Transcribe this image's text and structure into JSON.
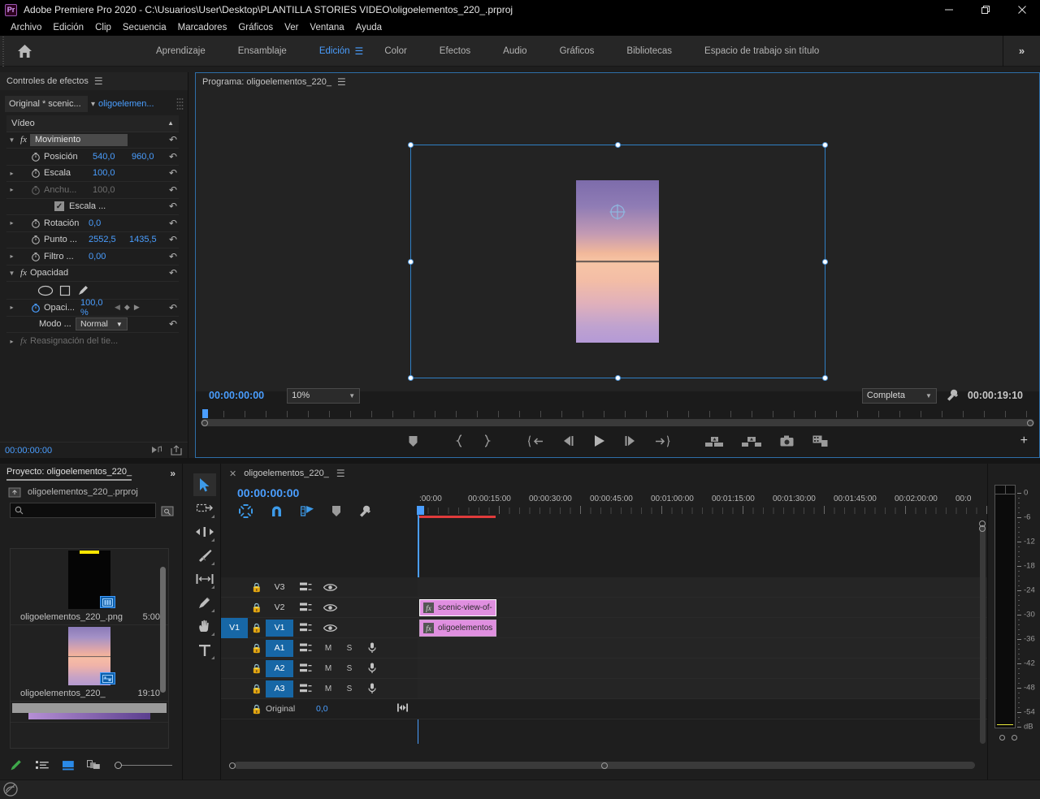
{
  "window": {
    "app_title": "Adobe Premiere Pro 2020 - C:\\Usuarios\\User\\Desktop\\PLANTILLA STORIES VIDEO\\oligoelementos_220_.prproj",
    "logo": "Pr",
    "minimize": "minimize-icon",
    "maximize": "maximize-icon",
    "close": "close-icon"
  },
  "menubar": {
    "items": [
      "Archivo",
      "Edición",
      "Clip",
      "Secuencia",
      "Marcadores",
      "Gráficos",
      "Ver",
      "Ventana",
      "Ayuda"
    ]
  },
  "workspace": {
    "home_icon": "home-icon",
    "tabs": [
      {
        "label": "Aprendizaje",
        "active": false
      },
      {
        "label": "Ensamblaje",
        "active": false
      },
      {
        "label": "Edición",
        "active": true
      },
      {
        "label": "Color",
        "active": false
      },
      {
        "label": "Efectos",
        "active": false
      },
      {
        "label": "Audio",
        "active": false
      },
      {
        "label": "Gráficos",
        "active": false
      },
      {
        "label": "Bibliotecas",
        "active": false
      },
      {
        "label": "Espacio de trabajo sin título",
        "active": false
      }
    ],
    "more": "»",
    "accent_color": "#4a9eff"
  },
  "effect_controls": {
    "title": "Controles de efectos",
    "source_clip": "Original * scenic...",
    "sequence": "oligoelemen...",
    "section_video": "Vídeo",
    "properties": [
      {
        "name": "Movimiento",
        "type": "effect-name-field",
        "value": "",
        "value2": ""
      },
      {
        "name": "Posición",
        "value": "540,0",
        "value2": "960,0"
      },
      {
        "name": "Escala",
        "value": "100,0",
        "value2": ""
      },
      {
        "name": "Anchu...",
        "value": "100,0",
        "value2": "",
        "disabled": true
      },
      {
        "name": "Escala ...",
        "value": "",
        "value2": "",
        "checkbox": true
      },
      {
        "name": "Rotación",
        "value": "0,0",
        "value2": ""
      },
      {
        "name": "Punto ...",
        "value": "2552,5",
        "value2": "1435,5"
      },
      {
        "name": "Filtro ...",
        "value": "0,00",
        "value2": ""
      }
    ],
    "opacity_section": "Opacidad",
    "opacity_prop": "Opaci...",
    "opacity_value": "100,0 %",
    "mode_label": "Modo ...",
    "mode_value": "Normal",
    "time_remap": "Reasignación del tie...",
    "timecode": "00:00:00:00"
  },
  "project": {
    "title": "Proyecto: oligoelementos_220_",
    "more": "»",
    "file": "oligoelementos_220_.prproj",
    "search_placeholder": "",
    "items": [
      {
        "name": "oligoelementos_220_.png",
        "duration": "5:00",
        "kind": "still-image",
        "badge": "film-strip-icon"
      },
      {
        "name": "oligoelementos_220_",
        "duration": "19:10",
        "kind": "sequence",
        "badge": "sequence-icon"
      }
    ],
    "footer_icons": [
      "new-item-icon",
      "list-view-icon",
      "icon-view-icon",
      "freeform-view-icon",
      "zoom-slider"
    ]
  },
  "program_monitor": {
    "title": "Programa: oligoelementos_220_",
    "timecode": "00:00:00:00",
    "zoom_level": "10%",
    "quality": "Completa",
    "duration": "00:00:19:10",
    "settings_icon": "wrench-icon",
    "transport": [
      "add-marker-icon",
      "mark-in-icon",
      "mark-out-icon",
      "go-to-in-icon",
      "step-back-icon",
      "play-icon",
      "step-forward-icon",
      "go-to-out-icon",
      "lift-icon",
      "extract-icon",
      "export-frame-icon",
      "button-editor-icon"
    ],
    "add_button": "+"
  },
  "tools": {
    "items": [
      {
        "name": "selection-tool",
        "glyph": "arrow",
        "active": true
      },
      {
        "name": "track-select-forward-tool",
        "glyph": "track-select"
      },
      {
        "name": "ripple-edit-tool",
        "glyph": "ripple"
      },
      {
        "name": "razor-tool",
        "glyph": "razor"
      },
      {
        "name": "slip-tool",
        "glyph": "slip"
      },
      {
        "name": "pen-tool",
        "glyph": "pen"
      },
      {
        "name": "hand-tool",
        "glyph": "hand"
      },
      {
        "name": "type-tool",
        "glyph": "T"
      }
    ]
  },
  "timeline": {
    "tab_title": "oligoelementos_220_",
    "playhead_timecode": "00:00:00:00",
    "tool_icons": [
      "nest-sequence-icon",
      "snap-icon",
      "linked-selection-icon",
      "add-marker-icon",
      "timeline-settings-icon"
    ],
    "ruler_labels": [
      ":00:00",
      "00:00:15:00",
      "00:00:30:00",
      "00:00:45:00",
      "00:01:00:00",
      "00:01:15:00",
      "00:01:30:00",
      "00:01:45:00",
      "00:02:00:00",
      "00:0"
    ],
    "tracks": [
      {
        "name": "V3",
        "type": "video",
        "targeted": false,
        "sync_label": ""
      },
      {
        "name": "V2",
        "type": "video",
        "targeted": false,
        "sync_label": ""
      },
      {
        "name": "V1",
        "type": "video",
        "targeted": true,
        "source_patch": "V1"
      },
      {
        "name": "A1",
        "type": "audio",
        "targeted": true,
        "mute": "M",
        "solo": "S"
      },
      {
        "name": "A2",
        "type": "audio",
        "targeted": true,
        "mute": "M",
        "solo": "S"
      },
      {
        "name": "A3",
        "type": "audio",
        "targeted": true,
        "mute": "M",
        "solo": "S"
      },
      {
        "name": "Original",
        "type": "master",
        "value": "0,0"
      }
    ],
    "clips": [
      {
        "label": "scenic-view-of-",
        "track": "V2",
        "selected": true,
        "fx": "fx"
      },
      {
        "label": "oligoelementos",
        "track": "V1",
        "selected": false,
        "fx": "fx"
      }
    ],
    "clip_color": "#e08fe0"
  },
  "audio_meter": {
    "scale_labels": [
      "0",
      "-6",
      "-12",
      "-18",
      "-24",
      "-30",
      "-36",
      "-42",
      "-48",
      "-54",
      "dB"
    ],
    "buttons": [
      "solo-left-icon",
      "solo-right-icon"
    ]
  },
  "statusbar": {
    "cc_icon": "creative-cloud-icon"
  }
}
